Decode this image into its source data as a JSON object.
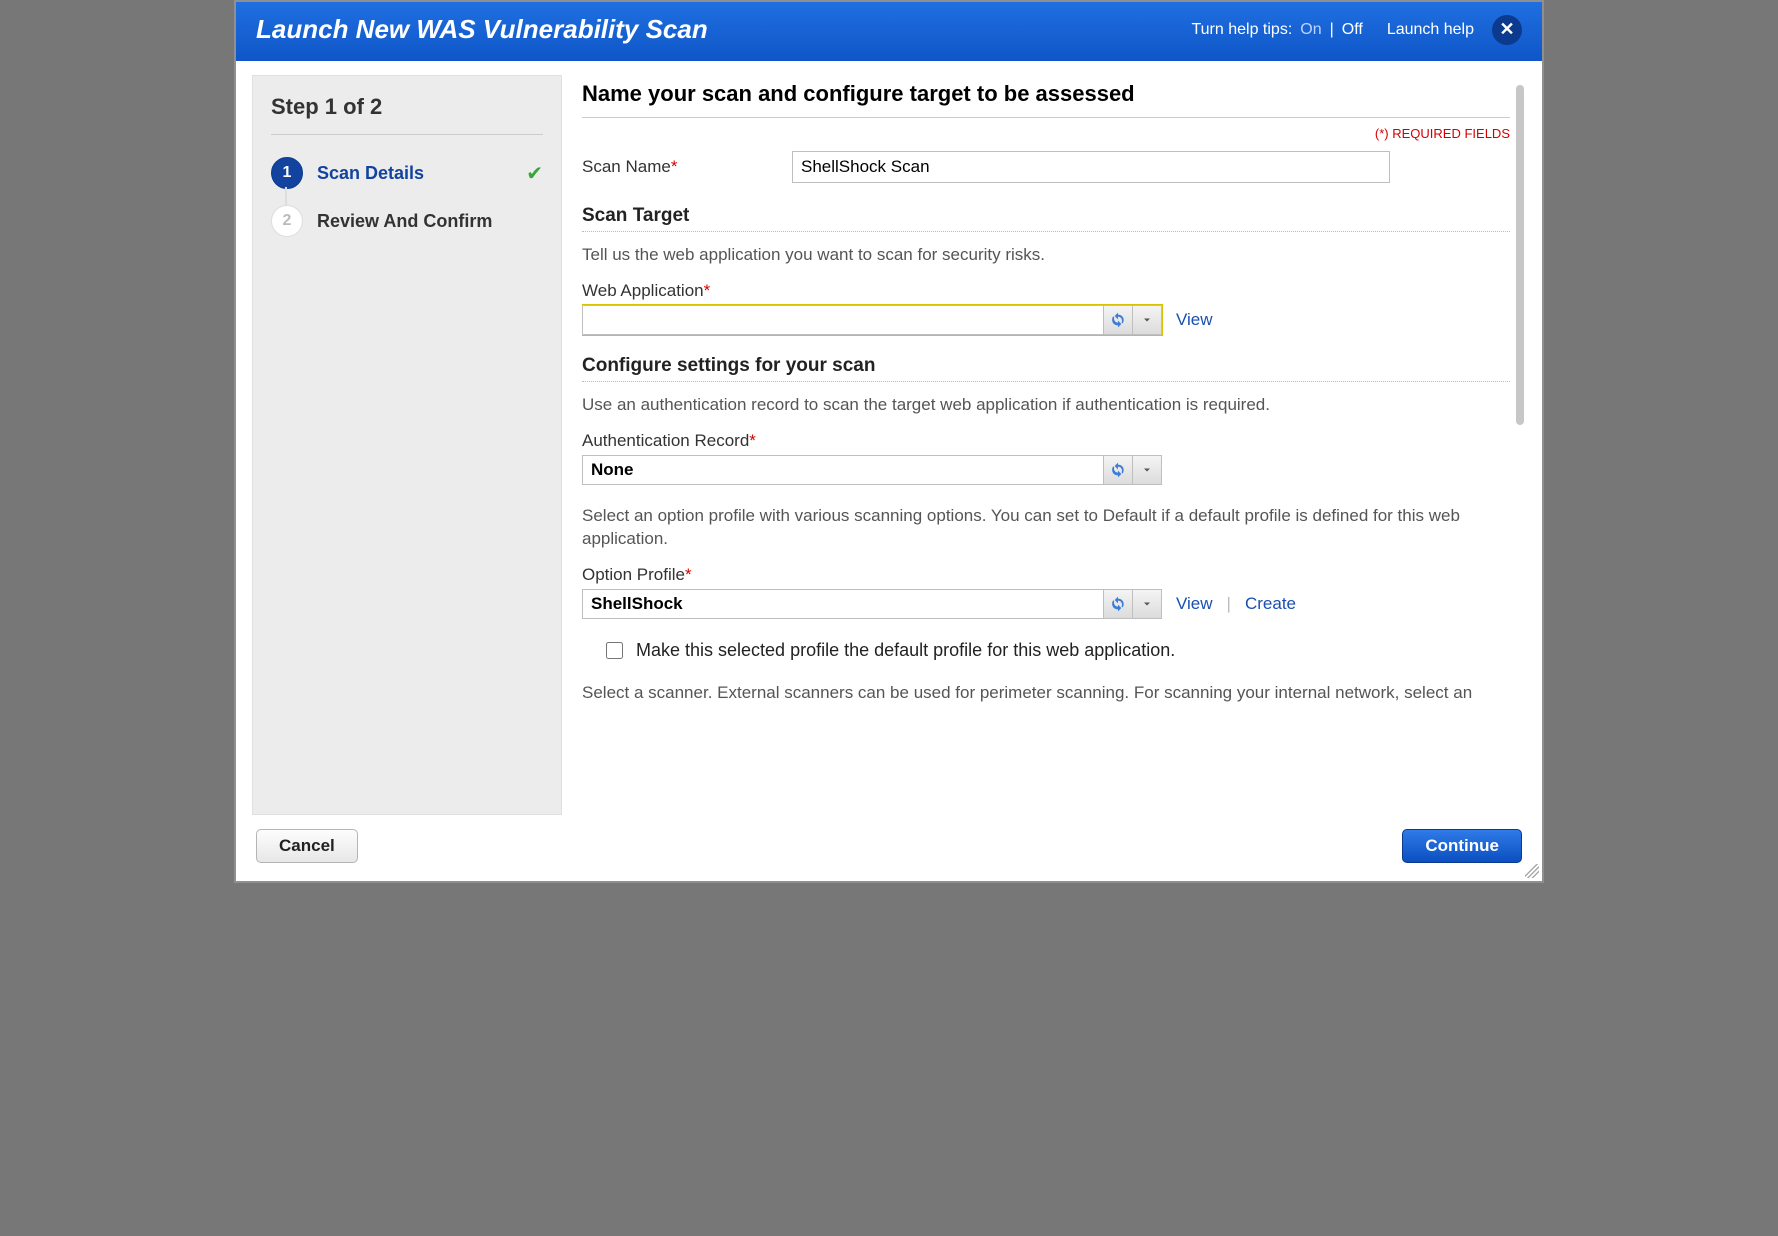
{
  "header": {
    "title": "Launch New WAS Vulnerability Scan",
    "help_tips_label": "Turn help tips:",
    "help_on": "On",
    "help_off": "Off",
    "launch_help": "Launch help"
  },
  "sidebar": {
    "step_indicator": "Step 1 of 2",
    "steps": [
      {
        "num": "1",
        "label": "Scan Details",
        "active": true,
        "checked": true
      },
      {
        "num": "2",
        "label": "Review And Confirm",
        "active": false,
        "checked": false
      }
    ]
  },
  "main": {
    "page_title": "Name your scan and configure target to be assessed",
    "required_note": "(*) REQUIRED FIELDS",
    "scan_name": {
      "label": "Scan Name",
      "value": "ShellShock Scan"
    },
    "scan_target": {
      "heading": "Scan Target",
      "desc": "Tell us the web application you want to scan for security risks.",
      "web_app": {
        "label": "Web Application",
        "value": "",
        "view": "View"
      }
    },
    "configure": {
      "heading": "Configure settings for your scan",
      "auth_desc": "Use an authentication record to scan the target web application if authentication is required.",
      "auth_record": {
        "label": "Authentication Record",
        "value": "None"
      },
      "profile_desc": "Select an option profile with various scanning options. You can set to Default if a default profile is defined for this web application.",
      "option_profile": {
        "label": "Option Profile",
        "value": "ShellShock",
        "view": "View",
        "create": "Create"
      },
      "default_checkbox_label": "Make this selected profile the default profile for this web application.",
      "scanner_desc": "Select a scanner. External scanners can be used for perimeter scanning. For scanning your internal network, select an"
    }
  },
  "footer": {
    "cancel": "Cancel",
    "continue": "Continue"
  }
}
